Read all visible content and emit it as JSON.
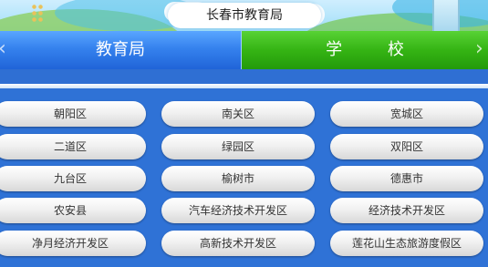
{
  "header": {
    "title": "长春市教育局"
  },
  "tabs": {
    "bureau_label": "教育局",
    "school_label": "学 校",
    "left_arrow_icon": "chevron-left-icon",
    "right_arrow_icon": "chevron-right-icon"
  },
  "districts": [
    "朝阳区",
    "南关区",
    "宽城区",
    "二道区",
    "绿园区",
    "双阳区",
    "九台区",
    "榆树市",
    "德惠市",
    "农安县",
    "汽车经济技术开发区",
    "经济技术开发区",
    "净月经济开发区",
    "高新技术开发区",
    "莲花山生态旅游度假区"
  ],
  "colors": {
    "tab_blue": "#3582ee",
    "tab_green": "#35b414",
    "grid_background": "#2f72d6"
  }
}
